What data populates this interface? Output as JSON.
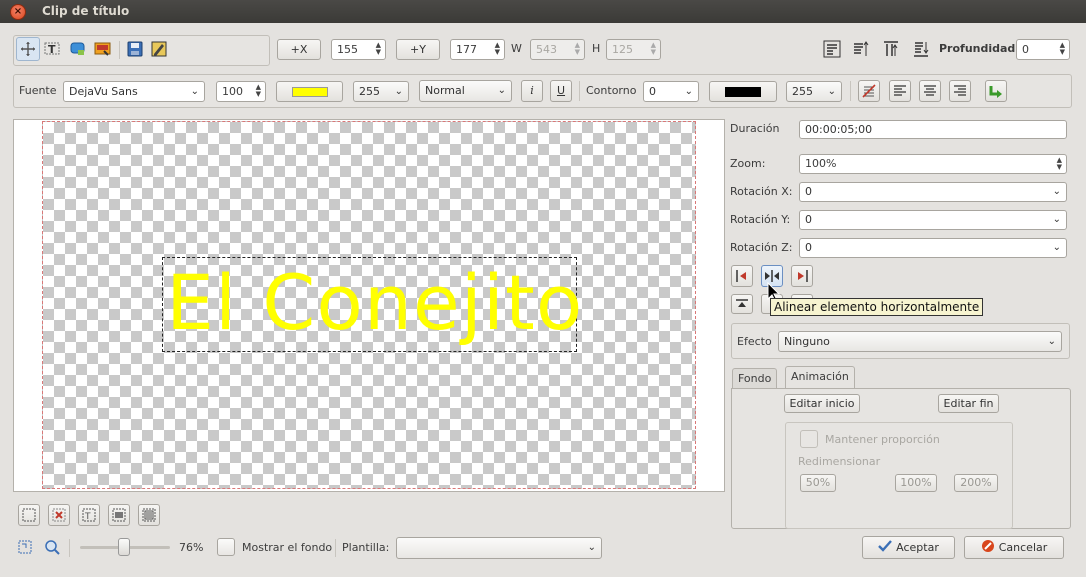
{
  "window": {
    "title": "Clip de título",
    "close_icon": "×"
  },
  "toolbar1": {
    "x_button": "+X",
    "x_value": "155",
    "y_button": "+Y",
    "y_value": "177",
    "w_label": "W",
    "w_value": "543",
    "h_label": "H",
    "h_value": "125",
    "depth_label": "Profundidad:",
    "depth_value": "0"
  },
  "toolbar2": {
    "font_label": "Fuente",
    "font_family": "DejaVu Sans",
    "font_size": "100",
    "font_color": "#ffff00",
    "font_alpha": "255",
    "font_weight": "Normal",
    "italic_glyph": "i",
    "underline_glyph": "U",
    "outline_label": "Contorno",
    "outline_width": "0",
    "outline_color": "#000000",
    "outline_alpha": "255"
  },
  "canvas": {
    "text": "El Conejito"
  },
  "properties": {
    "duration_label": "Duración",
    "duration_value": "00:00:05;00",
    "zoom_label": "Zoom:",
    "zoom_value": "100%",
    "rotx_label": "Rotación X:",
    "rotx_value": "0",
    "roty_label": "Rotación Y:",
    "roty_value": "0",
    "rotz_label": "Rotación Z:",
    "rotz_value": "0",
    "tooltip": "Alinear elemento horizontalmente",
    "effect_label": "Efecto",
    "effect_value": "Ninguno"
  },
  "tabs": {
    "background": "Fondo",
    "animation": "Animación"
  },
  "animation": {
    "edit_start": "Editar inicio",
    "edit_end": "Editar fin",
    "keep_ratio": "Mantener proporción",
    "resize_label": "Redimensionar",
    "p50": "50%",
    "p100": "100%",
    "p200": "200%"
  },
  "bottom": {
    "zoom_percent": "76%",
    "show_background": "Mostrar el fondo",
    "template_label": "Plantilla:",
    "template_value": "",
    "accept": "Aceptar",
    "cancel": "Cancelar"
  }
}
